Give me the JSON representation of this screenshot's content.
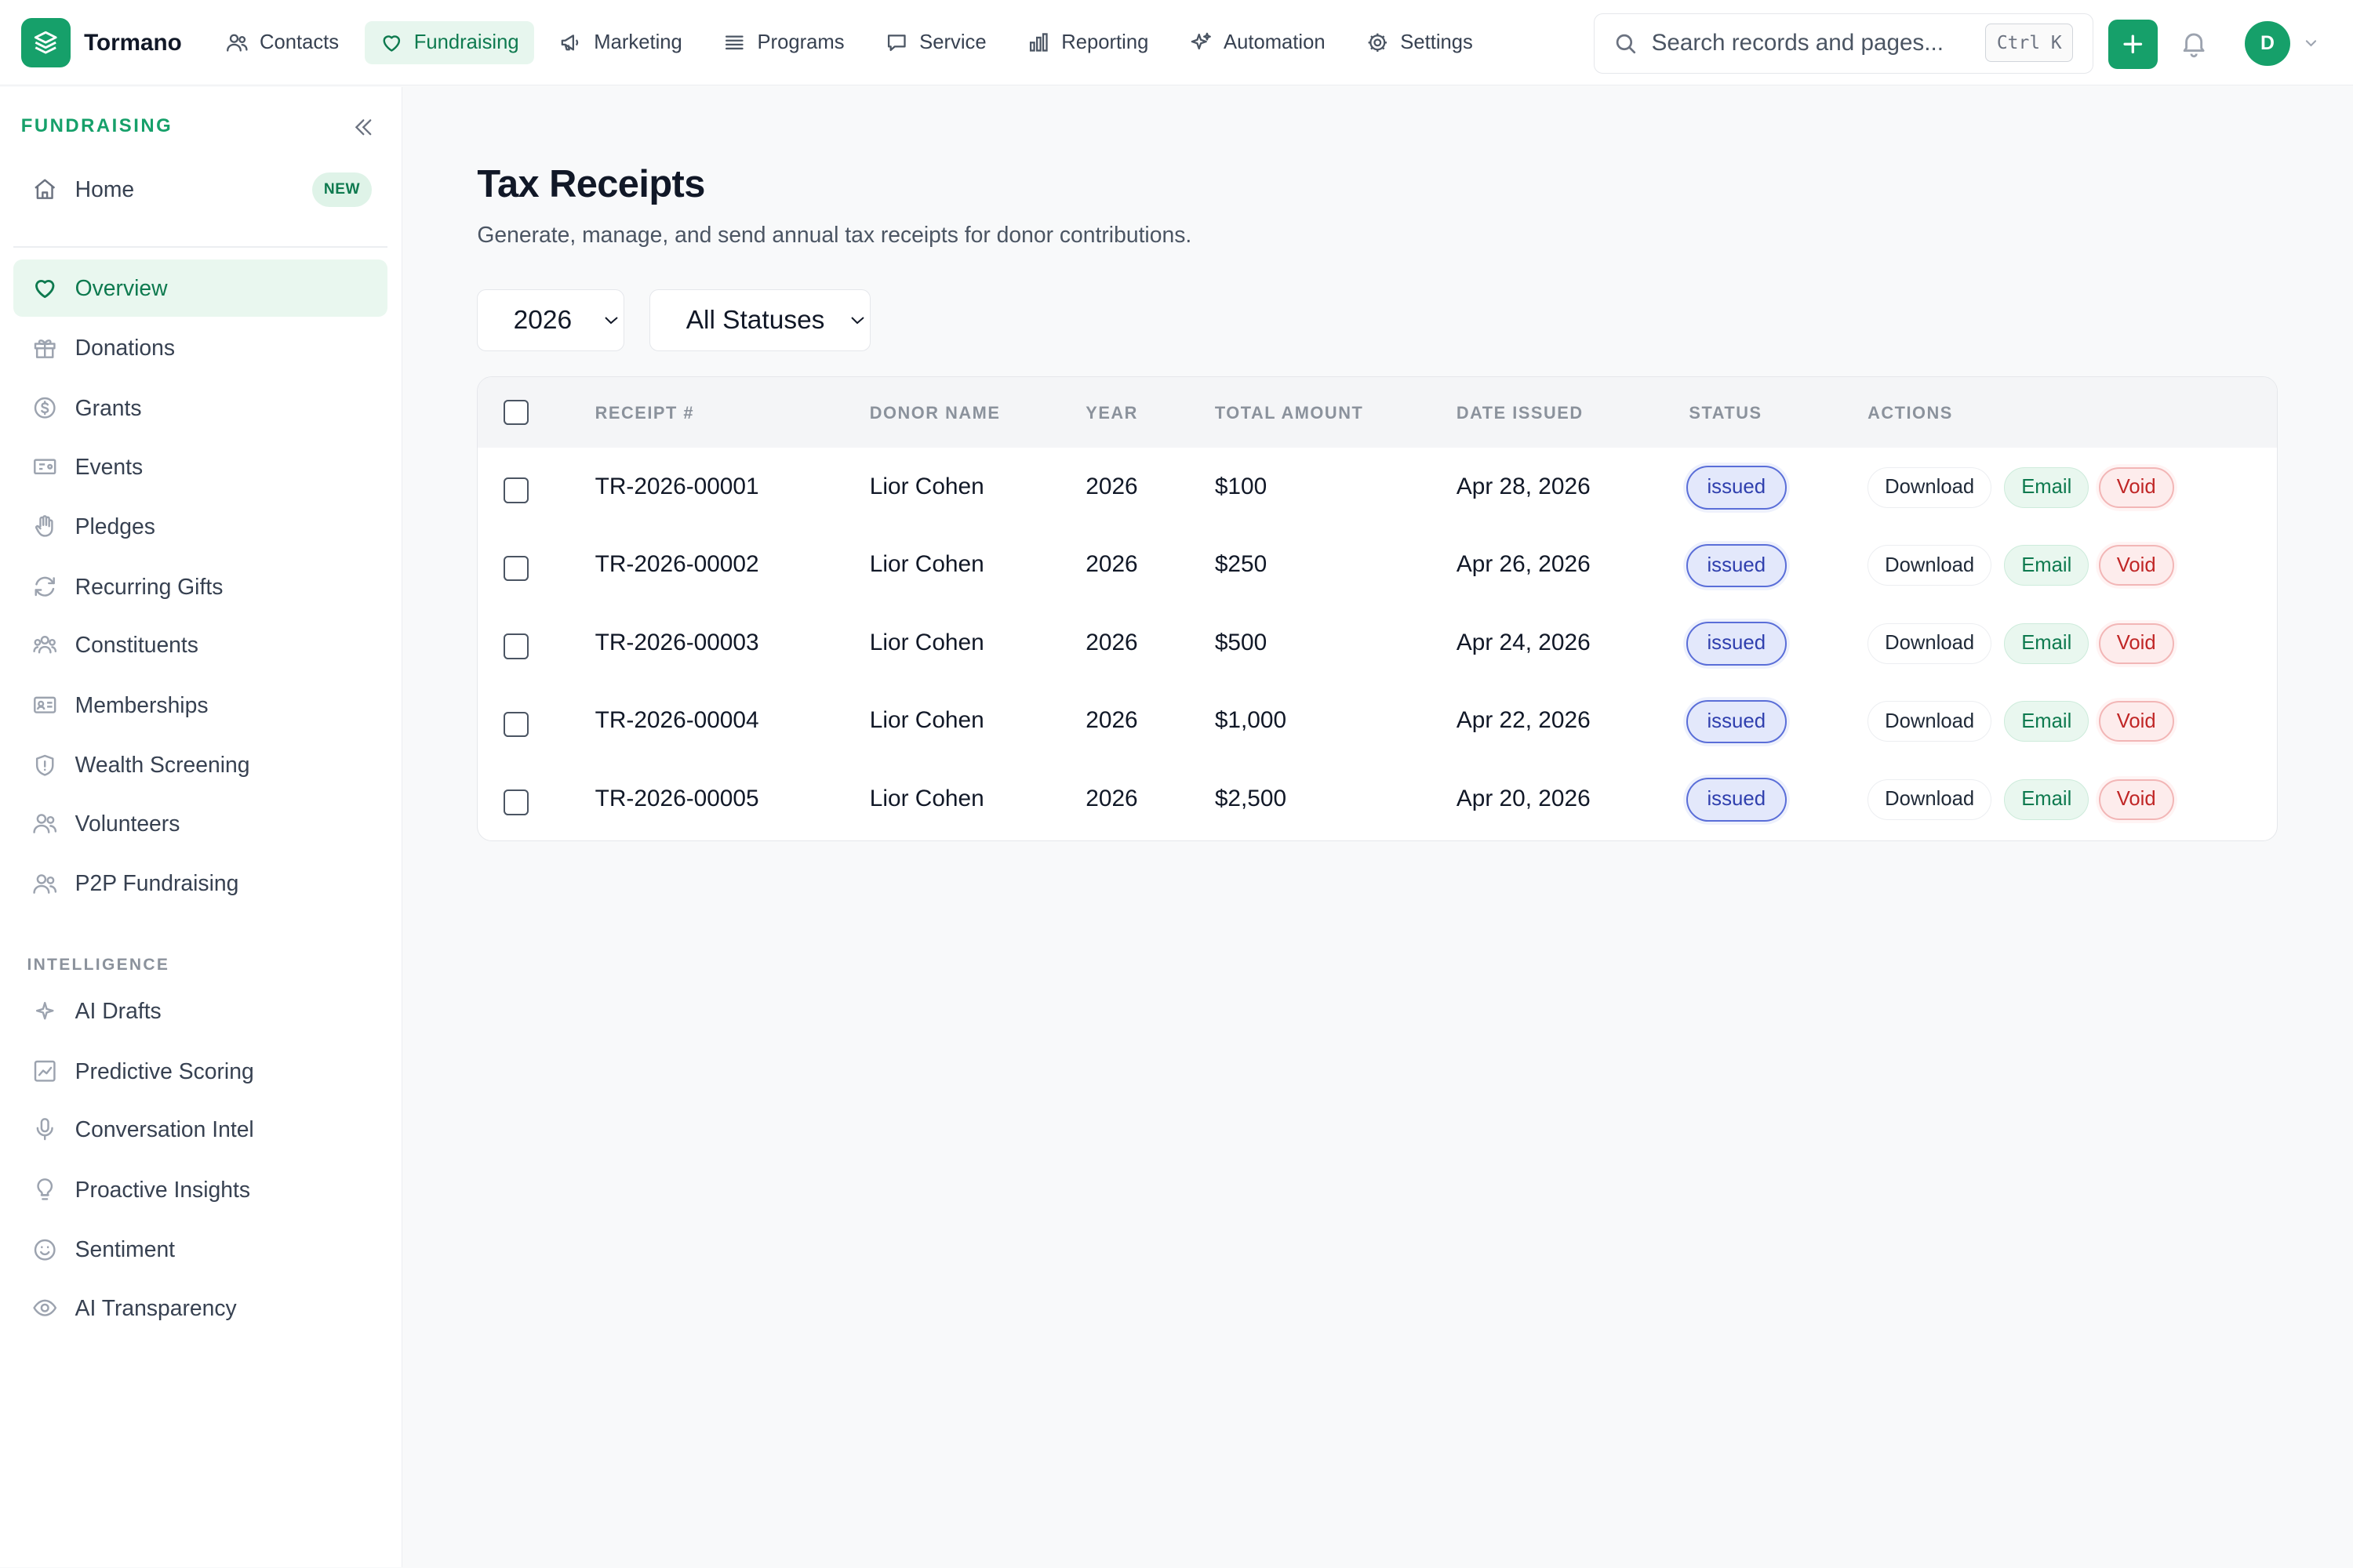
{
  "app": {
    "name": "Tormano"
  },
  "topnav": [
    {
      "label": "Contacts",
      "icon": "users-icon"
    },
    {
      "label": "Fundraising",
      "icon": "heart-icon",
      "active": true
    },
    {
      "label": "Marketing",
      "icon": "megaphone-icon"
    },
    {
      "label": "Programs",
      "icon": "list-icon"
    },
    {
      "label": "Service",
      "icon": "chat-icon"
    },
    {
      "label": "Reporting",
      "icon": "bar-chart-icon"
    },
    {
      "label": "Automation",
      "icon": "sparkles-icon"
    },
    {
      "label": "Settings",
      "icon": "gear-icon"
    }
  ],
  "search": {
    "placeholder": "Search records and pages...",
    "shortcut": "Ctrl K"
  },
  "user": {
    "initial": "D"
  },
  "colors": {
    "brand": "#16a06a",
    "active_bg": "#e9f7ef",
    "status_issued": "#5a6ed8",
    "void": "#c02626"
  },
  "sidebar": {
    "section": "FUNDRAISING",
    "home": {
      "label": "Home",
      "badge": "NEW",
      "icon": "home-icon"
    },
    "items": [
      {
        "label": "Overview",
        "icon": "heart-icon",
        "active": true
      },
      {
        "label": "Donations",
        "icon": "gift-icon"
      },
      {
        "label": "Grants",
        "icon": "dollar-circle-icon"
      },
      {
        "label": "Events",
        "icon": "ticket-icon"
      },
      {
        "label": "Pledges",
        "icon": "hand-icon"
      },
      {
        "label": "Recurring Gifts",
        "icon": "refresh-icon"
      },
      {
        "label": "Constituents",
        "icon": "people-icon"
      },
      {
        "label": "Memberships",
        "icon": "id-card-icon"
      },
      {
        "label": "Wealth Screening",
        "icon": "shield-icon"
      },
      {
        "label": "Volunteers",
        "icon": "users-icon"
      },
      {
        "label": "P2P Fundraising",
        "icon": "users-icon"
      }
    ],
    "intelligence_label": "INTELLIGENCE",
    "intelligence": [
      {
        "label": "AI Drafts",
        "icon": "sparkle-icon"
      },
      {
        "label": "Predictive Scoring",
        "icon": "trend-chart-icon"
      },
      {
        "label": "Conversation Intel",
        "icon": "microphone-icon"
      },
      {
        "label": "Proactive Insights",
        "icon": "lightbulb-icon"
      },
      {
        "label": "Sentiment",
        "icon": "smile-icon"
      },
      {
        "label": "AI Transparency",
        "icon": "eye-icon"
      }
    ]
  },
  "page": {
    "title": "Tax Receipts",
    "subtitle": "Generate, manage, and send annual tax receipts for donor contributions.",
    "year_filter": {
      "selected": "2026"
    },
    "status_filter": {
      "selected": "All Statuses"
    }
  },
  "table": {
    "columns": [
      "RECEIPT #",
      "DONOR NAME",
      "YEAR",
      "TOTAL AMOUNT",
      "DATE ISSUED",
      "STATUS",
      "ACTIONS"
    ],
    "actions": {
      "download": "Download",
      "email": "Email",
      "void": "Void"
    },
    "rows": [
      {
        "receipt": "TR-2026-00001",
        "donor": "Lior Cohen",
        "year": "2026",
        "amount": "$100",
        "date": "Apr 28, 2026",
        "status": "issued"
      },
      {
        "receipt": "TR-2026-00002",
        "donor": "Lior Cohen",
        "year": "2026",
        "amount": "$250",
        "date": "Apr 26, 2026",
        "status": "issued"
      },
      {
        "receipt": "TR-2026-00003",
        "donor": "Lior Cohen",
        "year": "2026",
        "amount": "$500",
        "date": "Apr 24, 2026",
        "status": "issued"
      },
      {
        "receipt": "TR-2026-00004",
        "donor": "Lior Cohen",
        "year": "2026",
        "amount": "$1,000",
        "date": "Apr 22, 2026",
        "status": "issued"
      },
      {
        "receipt": "TR-2026-00005",
        "donor": "Lior Cohen",
        "year": "2026",
        "amount": "$2,500",
        "date": "Apr 20, 2026",
        "status": "issued"
      }
    ]
  }
}
